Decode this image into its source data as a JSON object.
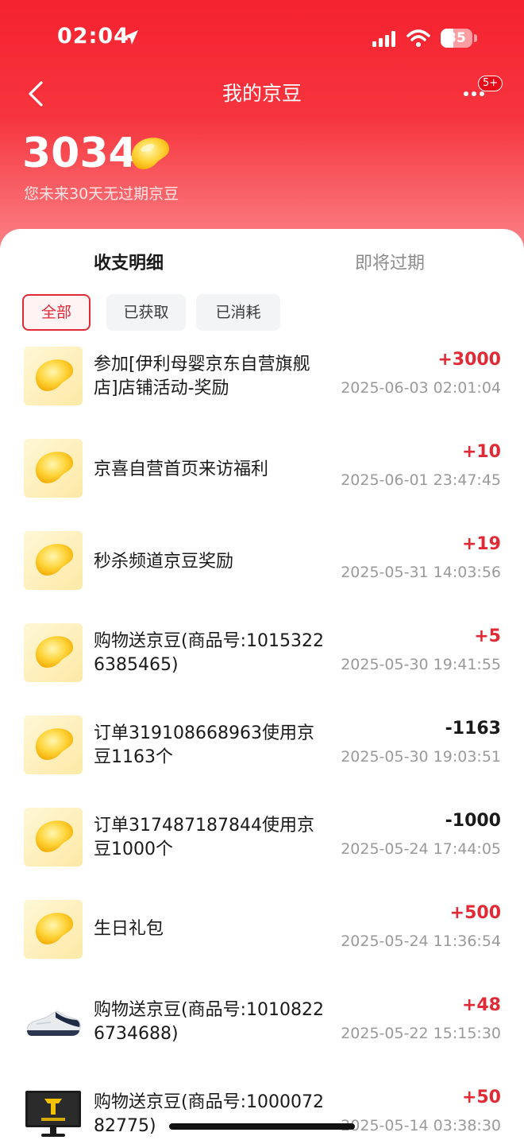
{
  "status_bar": {
    "time": "02:04",
    "battery": "35"
  },
  "header": {
    "title": "我的京豆",
    "badge": "5+",
    "balance": "3034",
    "expire_note": "您未来30天无过期京豆"
  },
  "tabs": [
    {
      "label": "收支明细",
      "active": true
    },
    {
      "label": "即将过期",
      "active": false
    }
  ],
  "filters": [
    {
      "label": "全部",
      "active": true
    },
    {
      "label": "已获取",
      "active": false
    },
    {
      "label": "已消耗",
      "active": false
    }
  ],
  "records": [
    {
      "title": "参加[伊利母婴京东自营旗舰店]店铺活动-奖励",
      "amount": "+3000",
      "time": "2025-06-03 02:01:04",
      "thumb": "bean-icon"
    },
    {
      "title": "京喜自营首页来访福利",
      "amount": "+10",
      "time": "2025-06-01 23:47:45",
      "thumb": "bean-icon"
    },
    {
      "title": "秒杀频道京豆奖励",
      "amount": "+19",
      "time": "2025-05-31 14:03:56",
      "thumb": "bean-icon"
    },
    {
      "title": "购物送京豆(商品号:10153226385465)",
      "amount": "+5",
      "time": "2025-05-30 19:41:55",
      "thumb": "bean-icon"
    },
    {
      "title": "订单319108668963使用京豆1163个",
      "amount": "-1163",
      "time": "2025-05-30 19:03:51",
      "thumb": "bean-icon"
    },
    {
      "title": "订单317487187844使用京豆1000个",
      "amount": "-1000",
      "time": "2025-05-24 17:44:05",
      "thumb": "bean-icon"
    },
    {
      "title": "生日礼包",
      "amount": "+500",
      "time": "2025-05-24 11:36:54",
      "thumb": "bean-icon"
    },
    {
      "title": "购物送京豆(商品号:10108226734688)",
      "amount": "+48",
      "time": "2025-05-22 15:15:30",
      "thumb": "sneaker-icon"
    },
    {
      "title": "购物送京豆(商品号:100007282775)",
      "amount": "+50",
      "time": "2025-05-14 03:38:30",
      "thumb": "monitor-icon"
    }
  ],
  "colors": {
    "brand_red": "#f5222f",
    "positive": "#e12a35",
    "negative": "#1a1a1a"
  }
}
